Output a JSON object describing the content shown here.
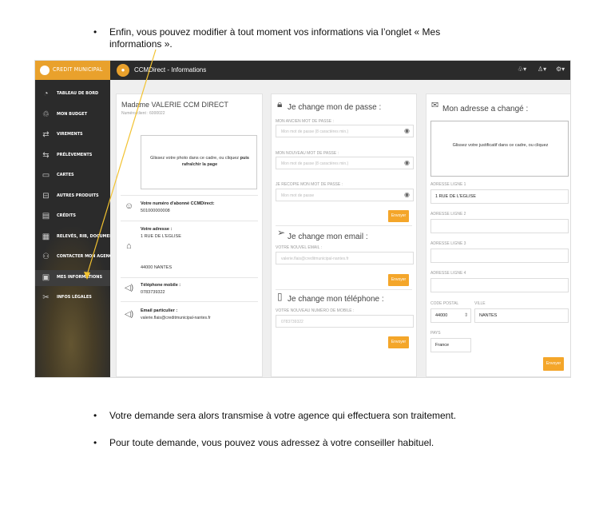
{
  "doc": {
    "bullet1_line1": "Enfin, vous pouvez modifier à tout moment vos informations via l’onglet « Mes",
    "bullet1_line2": "informations ».",
    "bullet2": "Votre demande sera alors transmise à votre agence qui effectuera son traitement.",
    "bullet3": "Pour toute demande, vous pouvez vous adressez à votre conseiller habituel.",
    "bullet_char": "•"
  },
  "app": {
    "brand": "CREDIT MUNICIPAL",
    "title": "CCMDirect - Informations",
    "accent": "#e9a12c"
  },
  "sidebar": {
    "items": [
      {
        "label": "TABLEAU DE BORD",
        "icon": "dashboard-icon",
        "glyph": "◔"
      },
      {
        "label": "MON BUDGET",
        "icon": "budget-icon",
        "glyph": "♲"
      },
      {
        "label": "VIREMENTS",
        "icon": "transfer-icon",
        "glyph": "⇄"
      },
      {
        "label": "PRÉLÈVEMENTS",
        "icon": "debit-icon",
        "glyph": "⇆"
      },
      {
        "label": "CARTES",
        "icon": "card-icon",
        "glyph": "▭"
      },
      {
        "label": "AUTRES PRODUITS",
        "icon": "products-icon",
        "glyph": "⊟"
      },
      {
        "label": "CRÉDITS",
        "icon": "credits-icon",
        "glyph": "▤"
      },
      {
        "label": "RELEVÉS, RIB, DOCUMENTS",
        "icon": "documents-icon",
        "glyph": "▦"
      },
      {
        "label": "CONTACTER MON AGENCE",
        "icon": "contact-icon",
        "glyph": "⚇"
      },
      {
        "label": "MES INFORMATIONS",
        "icon": "info-icon",
        "glyph": "▣"
      },
      {
        "label": "INFOS LÉGALES",
        "icon": "legal-icon",
        "glyph": "✂"
      }
    ]
  },
  "profile": {
    "name": "Madame VALERIE CCM DIRECT",
    "client_number": "Numéro client : 6000022",
    "photo_text_1": "Glissez votre photo dans ce cadre, ou cliquez",
    "photo_text_bold": "puis",
    "photo_text_2": "rafraîchir la page",
    "subscriber_label": "Votre numéro d'abonné CCMDirect:",
    "subscriber_value": "501000000008",
    "address_label": "Votre adresse :",
    "address_line1": "1 RUE DE L'EGLISE",
    "address_city": "44000 NANTES",
    "mobile_label": "Téléphone mobile :",
    "mobile_value": "0783739322",
    "email_label": "Email particulier :",
    "email_value": "valerie.flais@creditmunicipal-nantes.fr"
  },
  "password": {
    "title": "Je change mon de passe :",
    "old_label": "MON ANCIEN MOT DE PASSE :",
    "old_placeholder": "Mon mot de passe (8 caractères min.)",
    "new_label": "MON NOUVEAU MOT DE PASSE :",
    "new_placeholder": "Mon mot de passe (8 caractères min.)",
    "confirm_label": "JE RECOPIE MON MOT DE PASSE :",
    "confirm_placeholder": "Mon mot de passe",
    "submit": "Envoyer"
  },
  "email": {
    "title": "Je change mon email :",
    "label": "VOTRE NOUVEL EMAIL :",
    "placeholder": "valerie.flais@creditmunicipal-nantes.fr",
    "submit": "Envoyer"
  },
  "phone": {
    "title": "Je change mon téléphone :",
    "label": "VOTRE NOUVEAU NUMÉRO DE MOBILE :",
    "placeholder": "0783739322",
    "submit": "Envoyer"
  },
  "address": {
    "title": "Mon adresse a changé :",
    "drop_text": "Glissez votre justificatif dans ce cadre, ou cliquez",
    "line1_label": "ADRESSE LIGNE 1",
    "line1_value": "1 RUE DE L'EGLISE",
    "line2_label": "ADRESSE LIGNE 2",
    "line3_label": "ADRESSE LIGNE 3",
    "line4_label": "ADRESSE LIGNE 4",
    "postal_label": "CODE POSTAL",
    "postal_value": "44000",
    "city_label": "VILLE",
    "city_value": "NANTES",
    "country_label": "PAYS",
    "country_value": "France",
    "submit": "Envoyer"
  }
}
